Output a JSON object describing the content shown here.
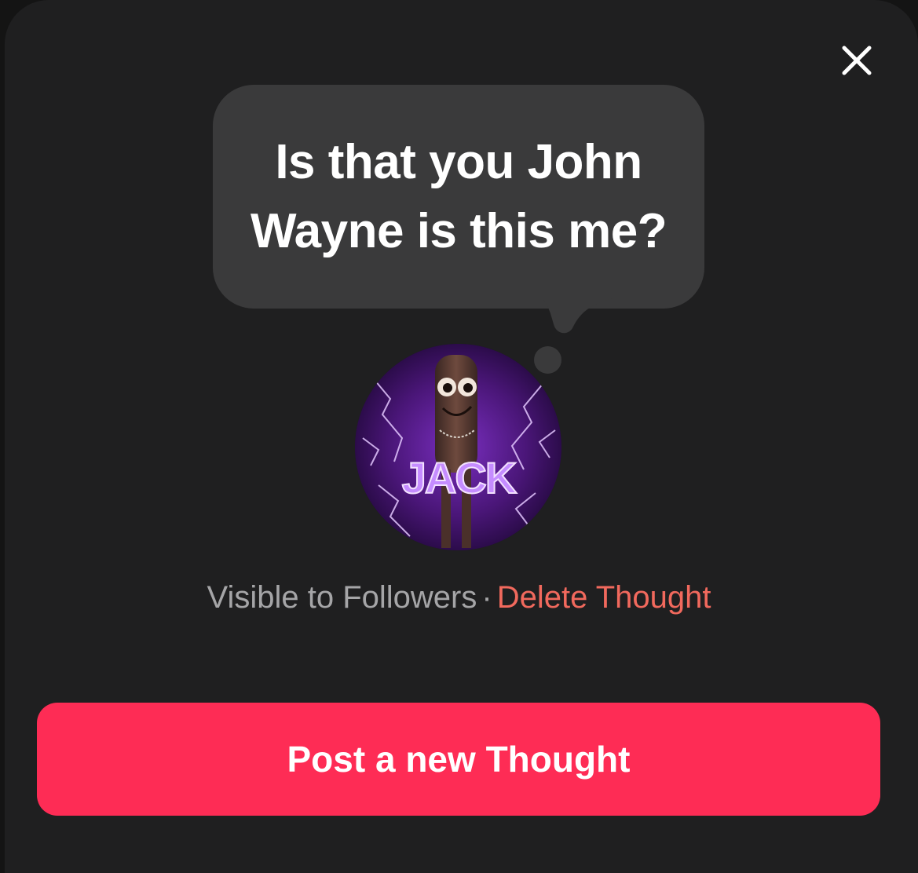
{
  "thought": {
    "text": "Is that you John Wayne is this me?"
  },
  "avatar": {
    "label": "JACK"
  },
  "meta": {
    "visibility": "Visible to Followers",
    "separator": "·",
    "delete_label": "Delete Thought"
  },
  "actions": {
    "post_label": "Post a new Thought",
    "close_icon": "close-icon"
  },
  "colors": {
    "background": "#1f1f20",
    "bubble": "#3a3a3b",
    "accent": "#fe2c55",
    "delete": "#f1695d",
    "muted_text": "#a5a5a7"
  }
}
